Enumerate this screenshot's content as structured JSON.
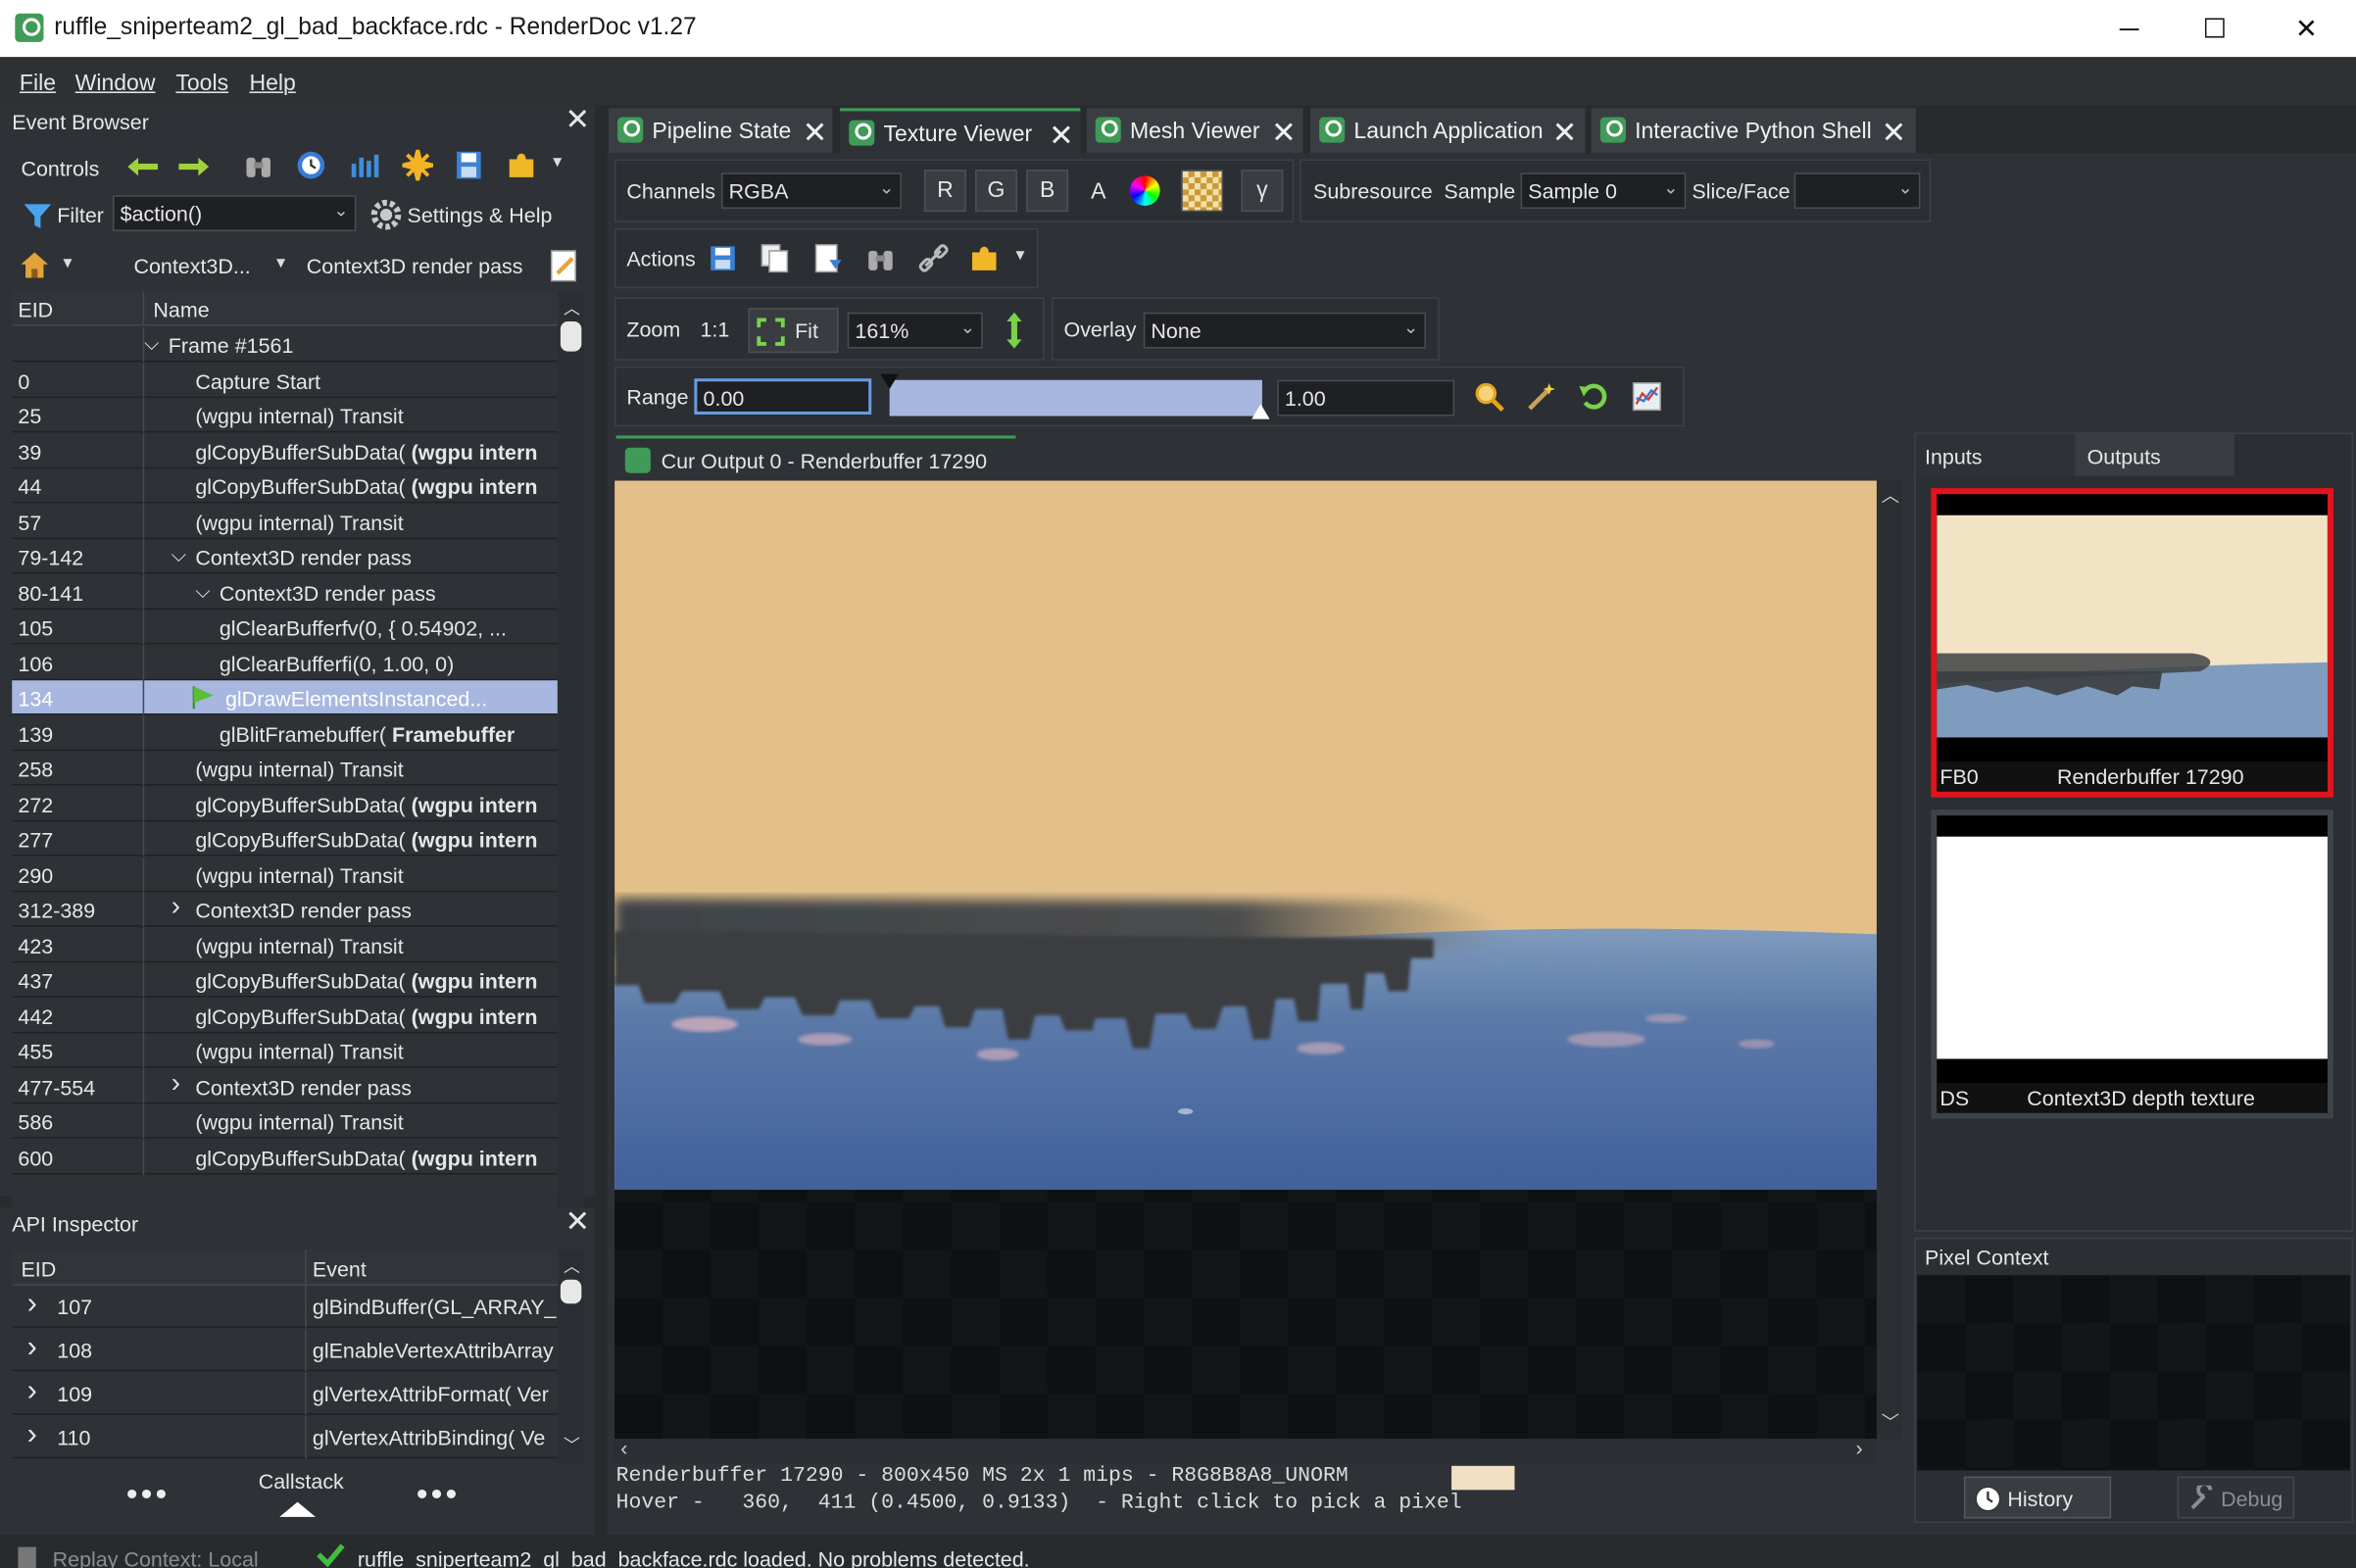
{
  "window": {
    "title": "ruffle_sniperteam2_gl_bad_backface.rdc - RenderDoc v1.27",
    "minimize": "─",
    "maximize": "☐",
    "close": "✕"
  },
  "menu": [
    "File",
    "Window",
    "Tools",
    "Help"
  ],
  "event_browser": {
    "title": "Event Browser",
    "controls_label": "Controls",
    "filter_label": "Filter",
    "filter_value": "$action()",
    "settings_label": "Settings & Help",
    "breadcrumb1": "Context3D...",
    "breadcrumb2": "Context3D render pass",
    "col_eid": "EID",
    "col_name": "Name",
    "rows": [
      {
        "eid": "",
        "name": "Frame #1561",
        "bold": ""
      },
      {
        "eid": "0",
        "name": "Capture Start",
        "bold": ""
      },
      {
        "eid": "25",
        "name": "(wgpu internal) Transit",
        "bold": ""
      },
      {
        "eid": "39",
        "name": "glCopyBufferSubData(",
        "bold": " (wgpu intern"
      },
      {
        "eid": "44",
        "name": "glCopyBufferSubData(",
        "bold": " (wgpu intern"
      },
      {
        "eid": "57",
        "name": "(wgpu internal) Transit",
        "bold": ""
      },
      {
        "eid": "79-142",
        "name": "Context3D render pass",
        "bold": ""
      },
      {
        "eid": "80-141",
        "name": "Context3D render pass",
        "bold": ""
      },
      {
        "eid": "105",
        "name": "glClearBufferfv(0, { 0.54902, ...",
        "bold": ""
      },
      {
        "eid": "106",
        "name": "glClearBufferfi(0, 1.00, 0)",
        "bold": ""
      },
      {
        "eid": "134",
        "name": "glDrawElementsInstanced...",
        "bold": ""
      },
      {
        "eid": "139",
        "name": "glBlitFramebuffer(",
        "bold": " Framebuffer"
      },
      {
        "eid": "258",
        "name": "(wgpu internal) Transit",
        "bold": ""
      },
      {
        "eid": "272",
        "name": "glCopyBufferSubData(",
        "bold": " (wgpu intern"
      },
      {
        "eid": "277",
        "name": "glCopyBufferSubData(",
        "bold": " (wgpu intern"
      },
      {
        "eid": "290",
        "name": "(wgpu internal) Transit",
        "bold": ""
      },
      {
        "eid": "312-389",
        "name": "Context3D render pass",
        "bold": ""
      },
      {
        "eid": "423",
        "name": "(wgpu internal) Transit",
        "bold": ""
      },
      {
        "eid": "437",
        "name": "glCopyBufferSubData(",
        "bold": " (wgpu intern"
      },
      {
        "eid": "442",
        "name": "glCopyBufferSubData(",
        "bold": " (wgpu intern"
      },
      {
        "eid": "455",
        "name": "(wgpu internal) Transit",
        "bold": ""
      },
      {
        "eid": "477-554",
        "name": "Context3D render pass",
        "bold": ""
      },
      {
        "eid": "586",
        "name": "(wgpu internal) Transit",
        "bold": ""
      },
      {
        "eid": "600",
        "name": "glCopyBufferSubData(",
        "bold": " (wgpu intern"
      }
    ]
  },
  "api_inspector": {
    "title": "API Inspector",
    "col_eid": "EID",
    "col_event": "Event",
    "rows": [
      {
        "eid": "107",
        "event": "glBindBuffer(GL_ARRAY_B"
      },
      {
        "eid": "108",
        "event": "glEnableVertexAttribArray"
      },
      {
        "eid": "109",
        "event": "glVertexAttribFormat( Ver"
      },
      {
        "eid": "110",
        "event": "glVertexAttribBinding( Ve"
      }
    ],
    "callstack_label": "Callstack"
  },
  "tabs": [
    {
      "label": "Pipeline State"
    },
    {
      "label": "Texture Viewer"
    },
    {
      "label": "Mesh Viewer"
    },
    {
      "label": "Launch Application"
    },
    {
      "label": "Interactive Python Shell"
    }
  ],
  "texture_viewer": {
    "channels_label": "Channels",
    "channels_value": "RGBA",
    "r": "R",
    "g": "G",
    "b": "B",
    "a": "A",
    "gamma": "γ",
    "subresource_label": "Subresource",
    "sample_label": "Sample",
    "sample_value": "Sample 0",
    "slice_label": "Slice/Face",
    "actions_label": "Actions",
    "zoom_label": "Zoom",
    "zoom_11": "1:1",
    "fit_label": "Fit",
    "zoom_value": "161%",
    "overlay_label": "Overlay",
    "overlay_value": "None",
    "range_label": "Range",
    "range_min": "0.00",
    "range_max": "1.00",
    "output_tab": "Cur Output 0 - Renderbuffer 17290",
    "status_line1": "Renderbuffer 17290 - 800x450 MS 2x 1 mips - R8G8B8A8_UNORM",
    "status_line2": "Hover -   360,  411 (0.4500, 0.9133)  - Right click to pick a pixel"
  },
  "thumbs": {
    "inputs_tab": "Inputs",
    "outputs_tab": "Outputs",
    "fb0_slot": "FB0",
    "fb0_name": "Renderbuffer 17290",
    "ds_slot": "DS",
    "ds_name": "Context3D depth texture"
  },
  "pixel_context": {
    "title": "Pixel Context",
    "history": "History",
    "debug": "Debug"
  },
  "statusbar": {
    "replay": "Replay Context: Local",
    "message": "ruffle_sniperteam2_gl_bad_backface.rdc loaded. No problems detected."
  },
  "colors": {
    "accent_green": "#3f9b57",
    "selection": "#a8b7e0",
    "highlight_red": "#e0141e",
    "sky": "#e3c08a",
    "water": "#4e6ea0"
  }
}
